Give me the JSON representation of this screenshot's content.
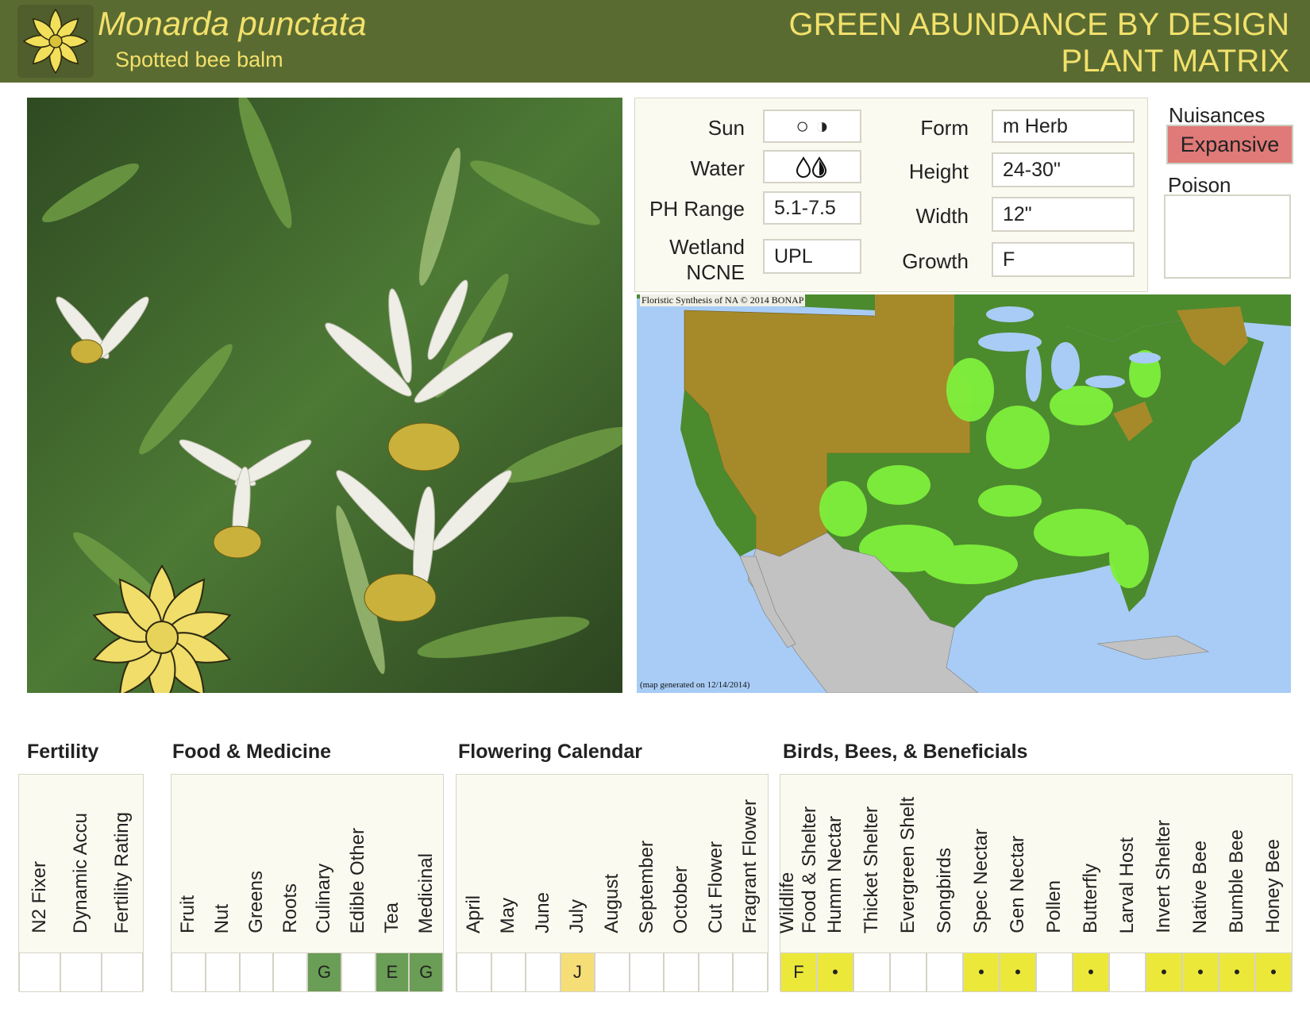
{
  "header": {
    "scientific_name": "Monarda punctata",
    "common_name": "Spotted bee balm",
    "brand_line1": "GREEN ABUNDANCE BY DESIGN",
    "brand_line2": "PLANT MATRIX"
  },
  "properties": {
    "sun_label": "Sun",
    "sun_icons": "○ ◑",
    "water_label": "Water",
    "water_icons": "💧",
    "ph_label": "PH Range",
    "ph_value": "5.1-7.5",
    "wetland_label_1": "Wetland",
    "wetland_label_2": "NCNE",
    "wetland_value": "UPL",
    "form_label": "Form",
    "form_value": "m Herb",
    "height_label": "Height",
    "height_value": "24-30\"",
    "width_label": "Width",
    "width_value": "12\"",
    "growth_label": "Growth",
    "growth_value": "F"
  },
  "nuisances": {
    "title": "Nuisances",
    "badge": "Expansive"
  },
  "poison": {
    "title": "Poison"
  },
  "map": {
    "credit": "Floristic Synthesis of NA © 2014 BONAP",
    "generated": "(map generated on 12/14/2014)"
  },
  "fertility": {
    "title": "Fertility",
    "columns": [
      {
        "label": "N2 Fixer",
        "value": "",
        "color": ""
      },
      {
        "label": "Dynamic Accu",
        "value": "",
        "color": ""
      },
      {
        "label": "Fertility Rating",
        "value": "",
        "color": ""
      }
    ]
  },
  "food": {
    "title": "Food & Medicine",
    "columns": [
      {
        "label": "Fruit",
        "value": "",
        "color": ""
      },
      {
        "label": "Nut",
        "value": "",
        "color": ""
      },
      {
        "label": "Greens",
        "value": "",
        "color": ""
      },
      {
        "label": "Roots",
        "value": "",
        "color": ""
      },
      {
        "label": "Culinary",
        "value": "G",
        "color": "green"
      },
      {
        "label": "Edible Other",
        "value": "",
        "color": ""
      },
      {
        "label": "Tea",
        "value": "E",
        "color": "green"
      },
      {
        "label": "Medicinal",
        "value": "G",
        "color": "green"
      }
    ]
  },
  "flowering": {
    "title": "Flowering Calendar",
    "columns": [
      {
        "label": "April",
        "value": "",
        "color": ""
      },
      {
        "label": "May",
        "value": "",
        "color": ""
      },
      {
        "label": "June",
        "value": "",
        "color": ""
      },
      {
        "label": "July",
        "value": "J",
        "color": "tan"
      },
      {
        "label": "August",
        "value": "",
        "color": ""
      },
      {
        "label": "September",
        "value": "",
        "color": ""
      },
      {
        "label": "October",
        "value": "",
        "color": ""
      },
      {
        "label": "Cut Flower",
        "value": "",
        "color": ""
      },
      {
        "label": "Fragrant Flower",
        "value": "",
        "color": ""
      }
    ]
  },
  "birds": {
    "title": "Birds, Bees, & Beneficials",
    "columns": [
      {
        "label": "Wildlife",
        "label2": "Food & Shelter",
        "value": "F",
        "color": "yellow"
      },
      {
        "label": "Humm Nectar",
        "value": "•",
        "color": "yellow"
      },
      {
        "label": "Thicket Shelter",
        "value": "",
        "color": ""
      },
      {
        "label": "Evergreen Shelt",
        "value": "",
        "color": ""
      },
      {
        "label": "Songbirds",
        "value": "",
        "color": ""
      },
      {
        "label": "Spec Nectar",
        "value": "•",
        "color": "yellow"
      },
      {
        "label": "Gen Nectar",
        "value": "•",
        "color": "yellow"
      },
      {
        "label": "Pollen",
        "value": "",
        "color": ""
      },
      {
        "label": "Butterfly",
        "value": "•",
        "color": "yellow"
      },
      {
        "label": "Larval  Host",
        "value": "",
        "color": ""
      },
      {
        "label": "Invert Shelter",
        "value": "•",
        "color": "yellow"
      },
      {
        "label": "Native Bee",
        "value": "•",
        "color": "yellow"
      },
      {
        "label": "Bumble Bee",
        "value": "•",
        "color": "yellow"
      },
      {
        "label": "Honey Bee",
        "value": "•",
        "color": "yellow"
      }
    ]
  }
}
